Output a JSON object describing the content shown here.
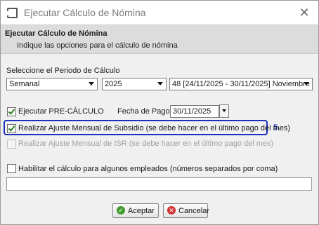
{
  "window": {
    "title": "Ejecutar Cálculo de Nómina"
  },
  "header": {
    "title": "Ejecutar Cálculo de Nómina",
    "subtitle": "Indique las opciones para el cálculo de nómina"
  },
  "period": {
    "label": "Seleccione el Periodo de Cálculo",
    "type_value": "Semanal",
    "year_value": "2025",
    "period_value": "48 [24/11/2025 - 30/11/2025] Noviembre"
  },
  "options": {
    "precalc_label": "Ejecutar PRE-CÁLCULO",
    "precalc_checked": true,
    "payment_date_label": "Fecha de Pago",
    "payment_date_value": "30/11/2025",
    "subsidy_label": "Realizar Ajuste Mensual de Subsidio (se debe hacer en el último pago del mes)",
    "subsidy_checked": true,
    "isr_label": "Realizar Ajuste Mensual de ISR (se debe hacer en el último pago del mes)",
    "isr_checked": false,
    "isr_enabled": false,
    "employees_label": "Habilitar el cálculo para algunos empleados (números separados por coma)",
    "employees_checked": false,
    "employees_value": ""
  },
  "annotation": {
    "step": "5.",
    "color": "#1a2fbf"
  },
  "buttons": {
    "accept_label": "Aceptar",
    "cancel_label": "Cancelar"
  },
  "icons": {
    "app": "window-icon",
    "close": "close-icon",
    "accept": "check-circle-icon",
    "cancel": "x-circle-icon"
  }
}
